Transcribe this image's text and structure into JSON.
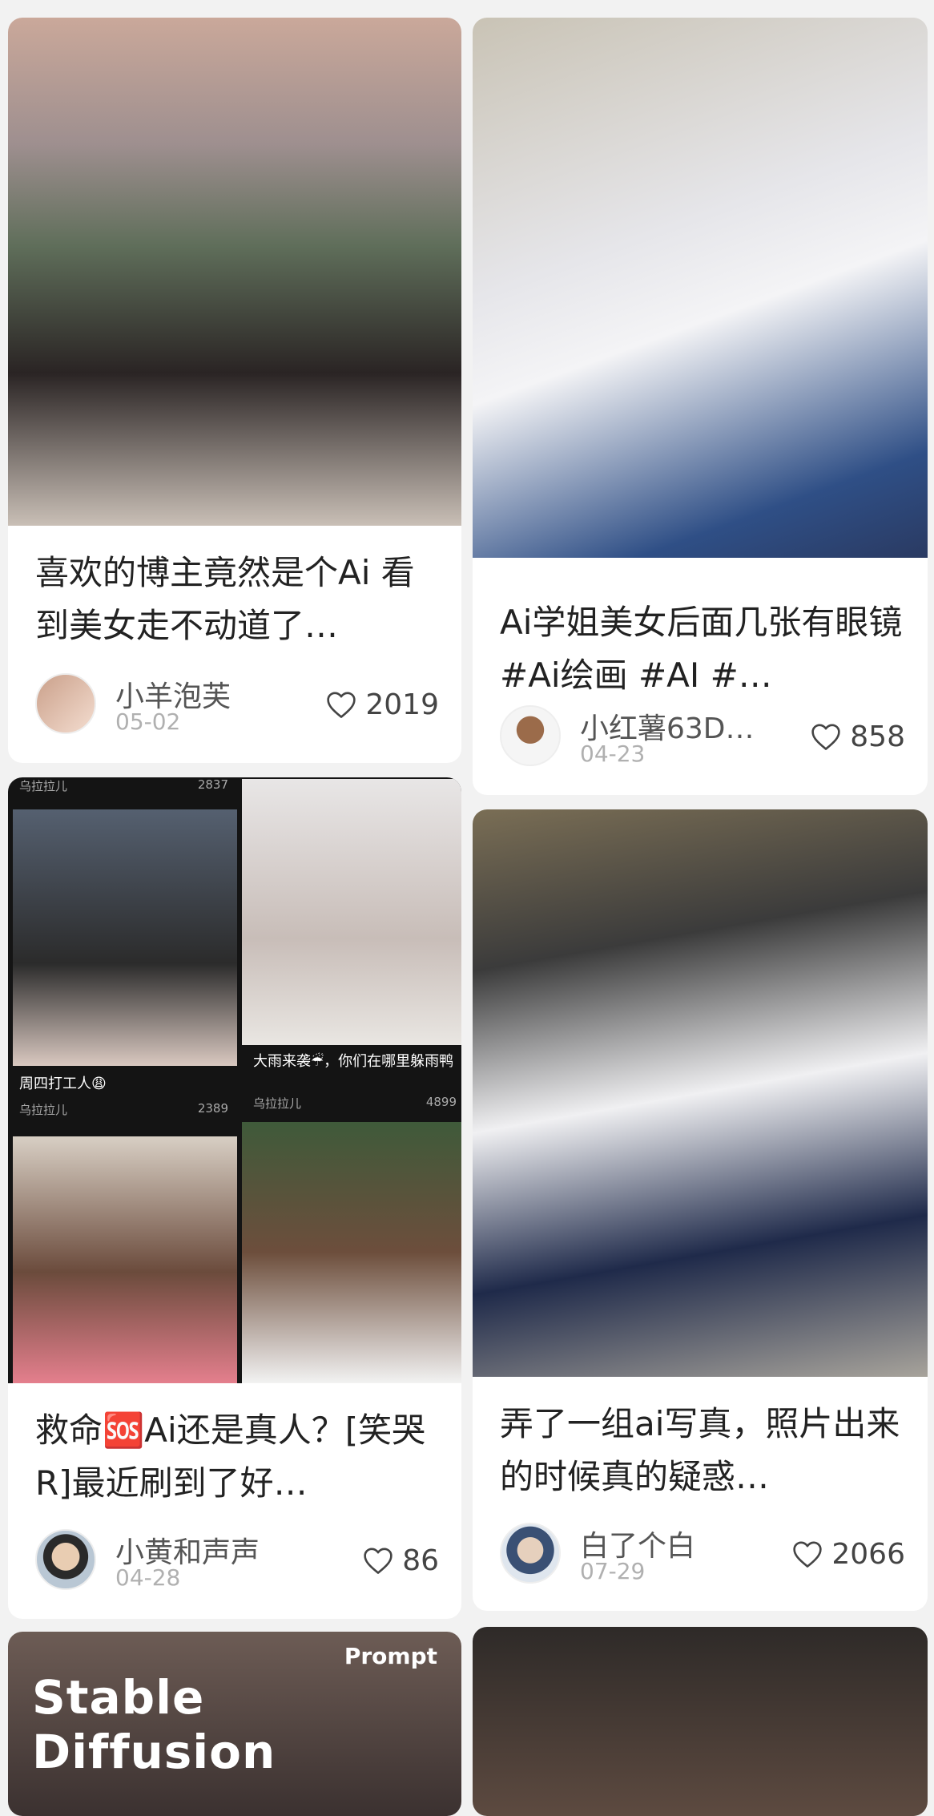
{
  "feed": [
    {
      "title": "喜欢的博主竟然是个Ai 看到美女走不动道了…",
      "author": "小羊泡芙",
      "date": "05-02",
      "likes": "2019"
    },
    {
      "title": "Ai学姐美女后面几张有眼镜 #Ai绘画 #AI #…",
      "author": "小红薯63D…",
      "date": "04-23",
      "likes": "858"
    },
    {
      "title": "救命🆘Ai还是真人？[笑哭R]最近刷到了好…",
      "author": "小黄和声声",
      "date": "04-28",
      "likes": "86",
      "collage": {
        "top_left_author": "乌拉拉儿",
        "top_left_likes": "2837",
        "caption_1": "周四打工人😩",
        "author_1": "乌拉拉儿",
        "likes_1": "2389",
        "caption_2": "大雨来袭☔，你们在哪里躲雨鸭",
        "author_2": "乌拉拉儿",
        "likes_2": "4899"
      }
    },
    {
      "title": "弄了一组ai写真，照片出来的时候真的疑惑…",
      "author": "白了个白",
      "date": "07-29",
      "likes": "2066"
    },
    {
      "overlay_prompt": "Prompt",
      "overlay_title": "Stable Diffusion"
    },
    {}
  ],
  "icons": {
    "like": "heart-icon"
  }
}
